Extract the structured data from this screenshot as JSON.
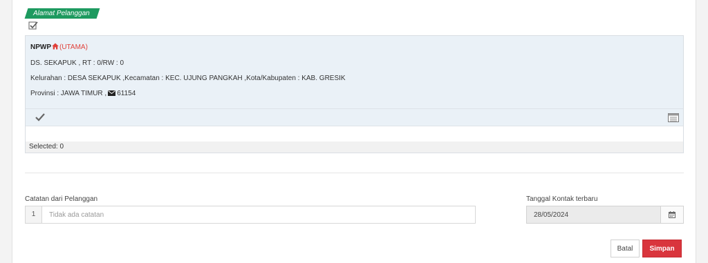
{
  "section": {
    "title": "Alamat Pelanggan"
  },
  "address": {
    "name": "NPWP",
    "primary_tag": "(UTAMA)",
    "line1": "DS. SEKAPUK , RT : 0/RW : 0",
    "line2": "Kelurahan : DESA SEKAPUK ,Kecamatan : KEC. UJUNG PANGKAH ,Kota/Kabupaten : KAB. GRESIK",
    "line3_prefix": "Provinsi : JAWA TIMUR ,",
    "postal_code": "61154"
  },
  "selection": {
    "status": "Selected: 0"
  },
  "notes": {
    "label": "Catatan dari Pelanggan",
    "index": "1",
    "placeholder": "Tidak ada catatan",
    "value": ""
  },
  "last_contact": {
    "label": "Tanggal Kontak terbaru",
    "value": "28/05/2024"
  },
  "actions": {
    "cancel_label": "Batal",
    "save_label": "Simpan"
  },
  "colors": {
    "ribbon": "#1d9a5f",
    "primary_tag": "#e0413a",
    "save_button": "#d9353d",
    "card_bg": "#eaf1f7"
  },
  "icons": [
    "checkbox-checked-icon",
    "home-icon",
    "mail-icon",
    "checkmark-icon",
    "list-view-icon",
    "calendar-icon"
  ]
}
